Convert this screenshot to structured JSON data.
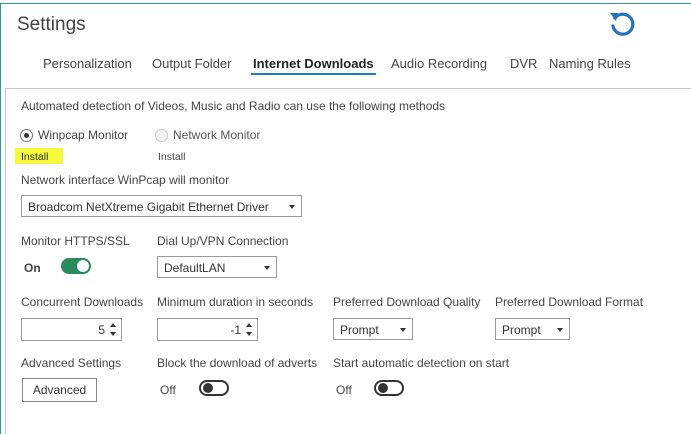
{
  "header": {
    "title": "Settings",
    "refresh_icon": "refresh-icon"
  },
  "tabs": [
    {
      "label": "Personalization"
    },
    {
      "label": "Output Folder"
    },
    {
      "label": "Internet Downloads"
    },
    {
      "label": "Audio Recording"
    },
    {
      "label": "DVR"
    },
    {
      "label": "Naming Rules"
    }
  ],
  "detection": {
    "description": "Automated detection of Videos, Music and Radio can use the following methods",
    "winpcap_label": "Winpcap Monitor",
    "winpcap_install": "Install",
    "network_label": "Network Monitor",
    "network_install": "Install"
  },
  "network_interface": {
    "label": "Network interface WinPcap will monitor",
    "value": "Broadcom NetXtreme Gigabit Ethernet Driver"
  },
  "monitor_https": {
    "label": "Monitor HTTPS/SSL",
    "state": "On"
  },
  "dialup": {
    "label": "Dial Up/VPN Connection",
    "value": "DefaultLAN"
  },
  "concurrent": {
    "label": "Concurrent Downloads",
    "value": "5"
  },
  "min_duration": {
    "label": "Minimum duration in seconds",
    "value": "-1"
  },
  "quality": {
    "label": "Preferred Download Quality",
    "value": "Prompt"
  },
  "format": {
    "label": "Preferred Download Format",
    "value": "Prompt"
  },
  "advanced": {
    "label": "Advanced Settings",
    "button": "Advanced"
  },
  "block_adverts": {
    "label": "Block the download of adverts",
    "state": "Off"
  },
  "auto_detect": {
    "label": "Start automatic detection on start",
    "state": "Off"
  },
  "colors": {
    "accent": "#1a7fc9",
    "toggle_on": "#2a8a5c",
    "highlight": "#f6f93e"
  }
}
